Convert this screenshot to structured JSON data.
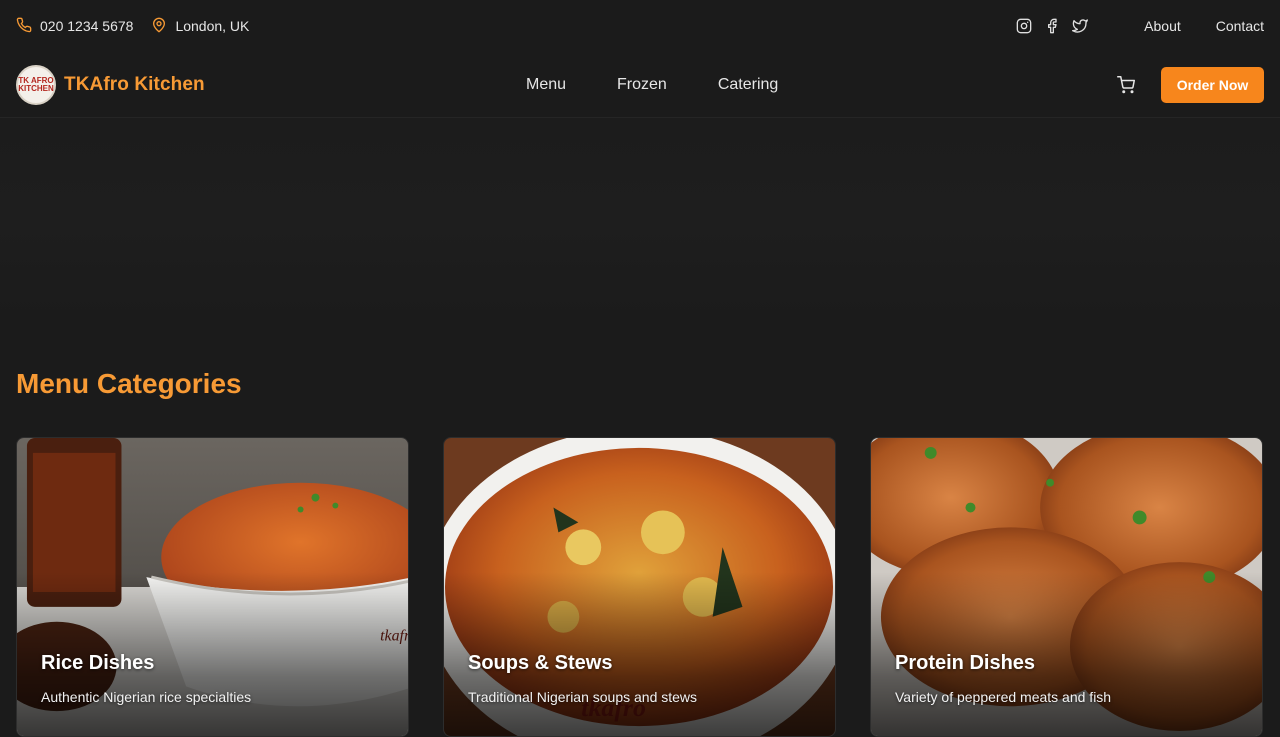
{
  "topbar": {
    "phone": "020 1234 5678",
    "location": "London, UK",
    "socials": [
      "instagram-icon",
      "facebook-icon",
      "twitter-icon"
    ],
    "links": [
      "About",
      "Contact"
    ]
  },
  "brand": {
    "logo_text": "TK AFRO KITCHEN",
    "name": "TKAfro Kitchen"
  },
  "nav": {
    "items": [
      "Menu",
      "Frozen",
      "Catering"
    ],
    "cart_icon": "cart-icon",
    "order_button": "Order Now"
  },
  "categories": {
    "title": "Menu Categories",
    "items": [
      {
        "title": "Rice Dishes",
        "description": "Authentic Nigerian rice specialties",
        "bowl_text": "tkafro"
      },
      {
        "title": "Soups & Stews",
        "description": "Traditional Nigerian soups and stews",
        "bowl_text": "tkafro"
      },
      {
        "title": "Protein Dishes",
        "description": "Variety of peppered meats and fish"
      }
    ]
  },
  "colors": {
    "accent": "#f79a35",
    "button": "#f7861c",
    "background": "#1b1b1b"
  }
}
